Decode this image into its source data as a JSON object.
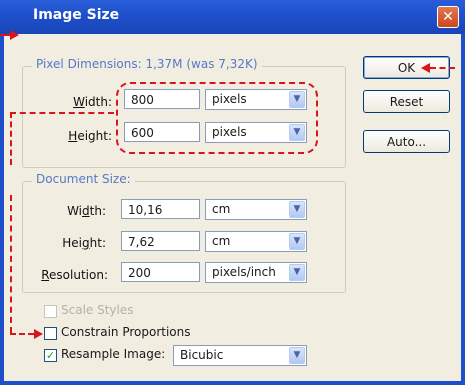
{
  "window": {
    "title": "Image Size",
    "close_glyph": "✕"
  },
  "pixel_dimensions": {
    "title": "Pixel Dimensions:  1,37M (was 7,32K)",
    "width": {
      "label": "Width:",
      "value": "800",
      "unit": "pixels"
    },
    "height": {
      "label": "Height:",
      "value": "600",
      "unit": "pixels"
    }
  },
  "document_size": {
    "title": "Document Size:",
    "width": {
      "label": "Width:",
      "value": "10,16",
      "unit": "cm"
    },
    "height": {
      "label": "Height:",
      "value": "7,62",
      "unit": "cm"
    },
    "resolution": {
      "label": "Resolution:",
      "value": "200",
      "unit": "pixels/inch"
    }
  },
  "options": {
    "scale_styles": {
      "label": "Scale Styles",
      "checked": false,
      "enabled": false
    },
    "constrain_proportions": {
      "label": "Constrain Proportions",
      "checked": false
    },
    "resample_image": {
      "label": "Resample Image:",
      "checked": true,
      "value": "Bicubic"
    }
  },
  "buttons": {
    "ok": "OK",
    "reset": "Reset",
    "auto": "Auto..."
  },
  "icons": {
    "dropdown": "chevron-down-icon",
    "check": "✓"
  },
  "colors": {
    "annotation": "#d8141c",
    "titlebar": "#1f4fcb",
    "group_title": "#5878c8"
  }
}
